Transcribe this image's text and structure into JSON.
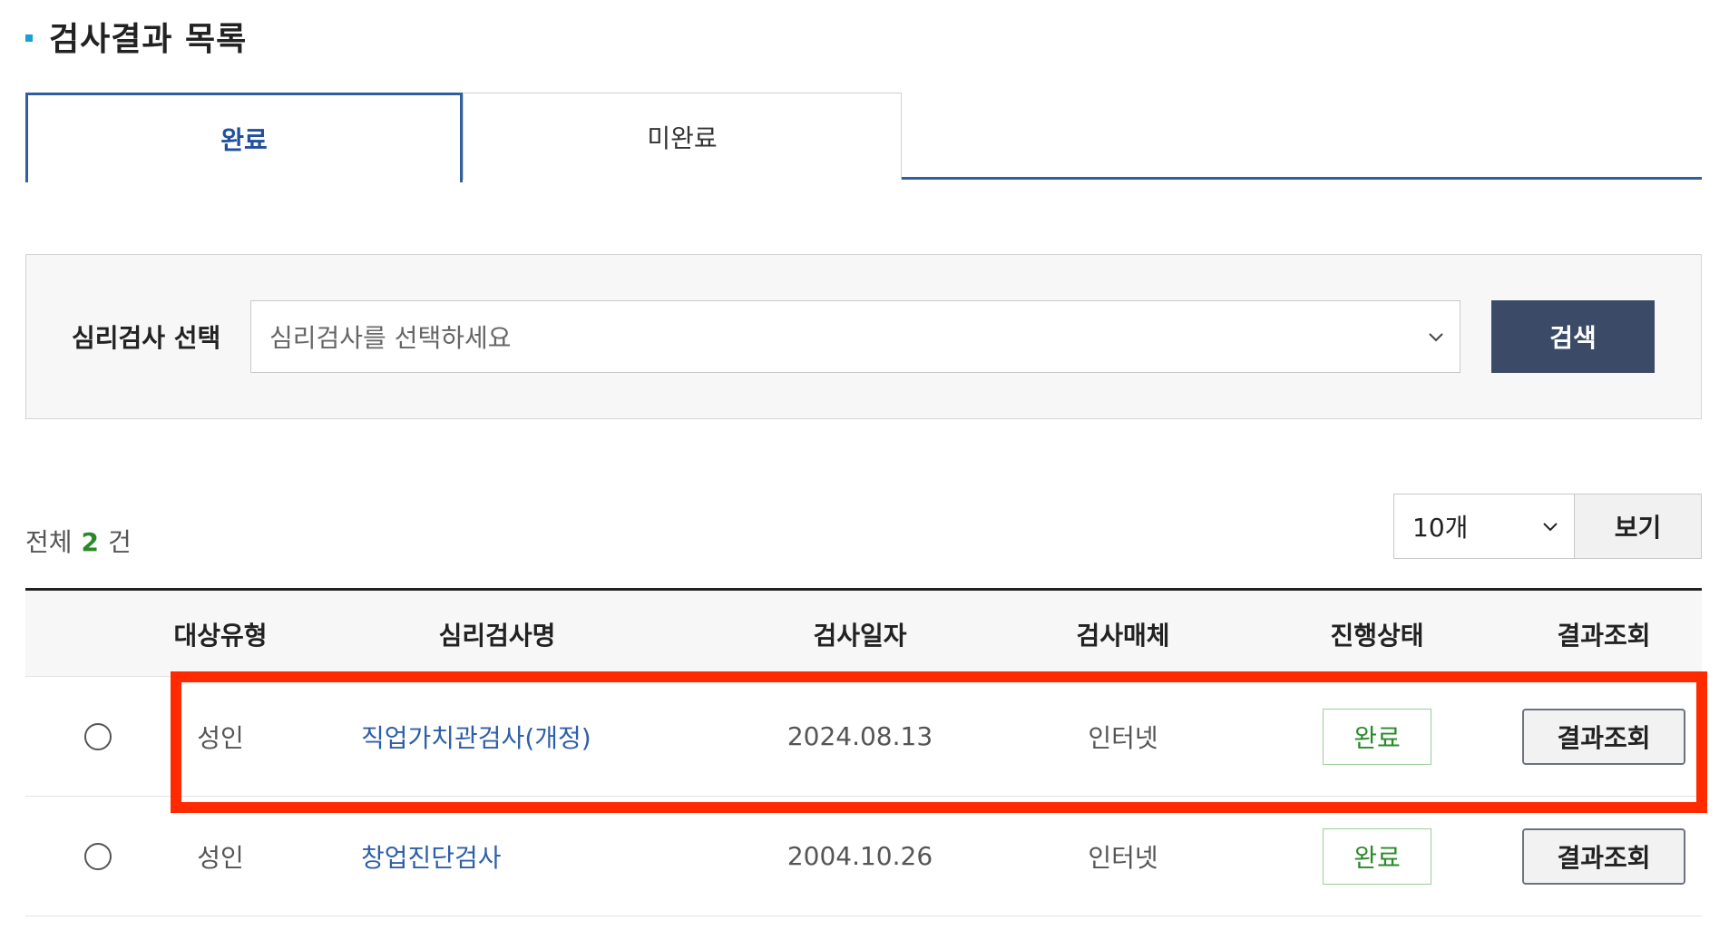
{
  "page_title": "검사결과 목록",
  "tabs": [
    {
      "label": "완료",
      "active": true
    },
    {
      "label": "미완료",
      "active": false
    }
  ],
  "search": {
    "label": "심리검사 선택",
    "placeholder": "심리검사를 선택하세요",
    "button_label": "검색"
  },
  "summary": {
    "prefix": "전체",
    "count": "2",
    "suffix": "건"
  },
  "per_page": {
    "selected": "10개",
    "button_label": "보기"
  },
  "table": {
    "headers": [
      "대상유형",
      "심리검사명",
      "검사일자",
      "검사매체",
      "진행상태",
      "결과조회"
    ],
    "rows": [
      {
        "target": "성인",
        "name": "직업가치관검사(개정)",
        "date": "2024.08.13",
        "media": "인터넷",
        "status": "완료",
        "action": "결과조회"
      },
      {
        "target": "성인",
        "name": "창업진단검사",
        "date": "2004.10.26",
        "media": "인터넷",
        "status": "완료",
        "action": "결과조회"
      }
    ]
  },
  "colors": {
    "accent_blue": "#2f5f9e",
    "search_button": "#3b4a66",
    "status_green": "#2a8a2a",
    "highlight_red": "#ff2a00"
  }
}
